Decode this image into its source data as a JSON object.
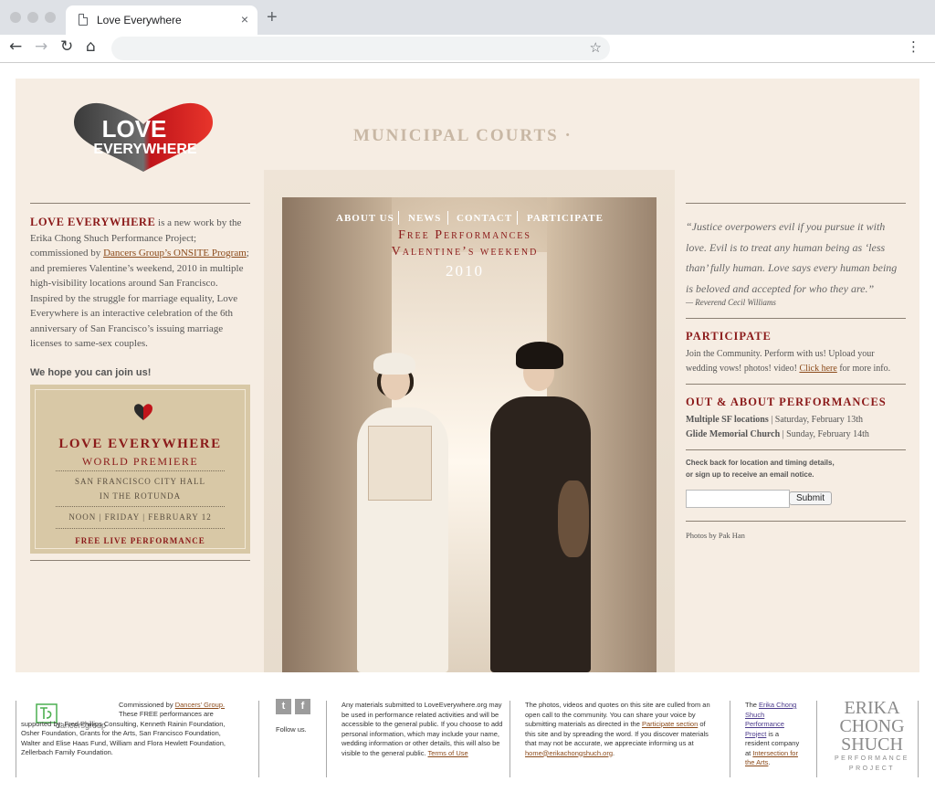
{
  "browser": {
    "tab_title": "Love Everywhere",
    "tab_close": "×",
    "new_tab": "+",
    "url": "",
    "icons": [
      "back-arrow-icon",
      "forward-arrow-icon",
      "reload-icon",
      "home-icon",
      "star-icon",
      "kebab-menu-icon"
    ]
  },
  "logo": {
    "line1": "LOVE",
    "line2": "EVERYWHERE"
  },
  "photo": {
    "building_sign": "MUNICIPAL COURTS ·"
  },
  "nav": {
    "items": [
      {
        "label": "ABOUT US"
      },
      {
        "label": "NEWS"
      },
      {
        "label": "CONTACT"
      },
      {
        "label": "PARTICIPATE"
      }
    ]
  },
  "promo": {
    "line1": "Free Performances",
    "line2": "Valentine’s weekend",
    "year": "2010"
  },
  "intro": {
    "lead": "LOVE EVERYWHERE",
    "text1": " is a new work by the Erika Chong Shuch Performance Project; commissioned by ",
    "link": "Dancers Group’s ONSITE Program",
    "text2": "; and premieres Valentine’s weekend, 2010 in multiple high-visibility locations around San Francisco. Inspired by the struggle for marriage equality, Love Everywhere is an interactive celebration of the 6th anniversary of San Francisco’s issuing marriage licenses to same-sex couples.",
    "hope": "We hope you can join us!"
  },
  "premiere": {
    "title": "LOVE EVERYWHERE",
    "subtitle": "WORLD PREMIERE",
    "venue1": "SAN FRANCISCO CITY HALL",
    "venue2": "IN THE ROTUNDA",
    "when": "NOON | FRIDAY | FEBRUARY 12",
    "free": "FREE LIVE PERFORMANCE"
  },
  "quote": {
    "text": "“Justice overpowers evil if you pursue it with love. Evil is to treat any human being as ‘less than’ fully human. Love says every human being is beloved and accepted for who they are.”",
    "attribution": "— Reverend Cecil Williams"
  },
  "participate": {
    "heading": "PARTICIPATE",
    "text1": "Join the Community. Perform with us! Upload your wedding vows! photos! video! ",
    "link": "Click here",
    "text2": " for more info."
  },
  "performances": {
    "heading": "OUT & ABOUT PERFORMANCES",
    "items": [
      {
        "where": "Multiple SF locations",
        "when": " | Saturday, February 13th"
      },
      {
        "where": "Glide Memorial Church",
        "when": " | Sunday, February 14th"
      }
    ]
  },
  "signup": {
    "text1": "Check back for location and timing details,",
    "text2": "or sign up to receive an email notice.",
    "email_value": "",
    "email_placeholder": "",
    "submit_label": "Submit"
  },
  "photo_credit": "Photos by Pak Han",
  "footer": {
    "dg_logo_text": "dancersgroup",
    "commissioned_pre": "Commissioned by ",
    "commissioned_link": "Dancers' Group.",
    "commissioned_text": " These FREE performances are supported by: Fred Phillips Consulting, Kenneth Rainin Foundation, Osher Foundation, Grants for the Arts, San Francisco Foundation, Walter and Elise Haas Fund, William and Flora Hewlett Foundation, Zellerbach Family Foundation.",
    "social_twitter": "t",
    "social_facebook": "f",
    "follow": "Follow us.",
    "materials_text": "Any materials submitted to LoveEverywhere.org may be used in performance related activities and will be accessible to the general public. If you choose to add personal information, which may include your name, wedding information or other details, this will also be visible to the general public. ",
    "terms_link": "Terms of Use",
    "photos_text1": "The photos, videos and quotes on this site are culled from an open call to the community. You can share your voice by submitting materials as directed in the ",
    "participate_link": "Participate section",
    "photos_text2": " of this site and by spreading the word. If you discover materials that may not be accurate, we appreciate informing us at ",
    "email_link": "home@erikachongshuch.org",
    "photos_text3": ".",
    "ecs_pre": "The ",
    "ecs_link": "Erika Chong Shuch Performance Project",
    "ecs_mid": " is a resident company at ",
    "ifa_link": "Intersection for the Arts",
    "ecs_end": ".",
    "ecs_logo": [
      "ERIKA",
      "CHONG",
      "SHUCH"
    ],
    "ecs_logo_sub": "PERFORMANCE PROJECT"
  },
  "colors": {
    "accent_red": "#8b1a1a",
    "page_bg": "#f6ede3",
    "link_brown": "#8b4a1a",
    "premiere_bg": "#d8c8a6"
  }
}
